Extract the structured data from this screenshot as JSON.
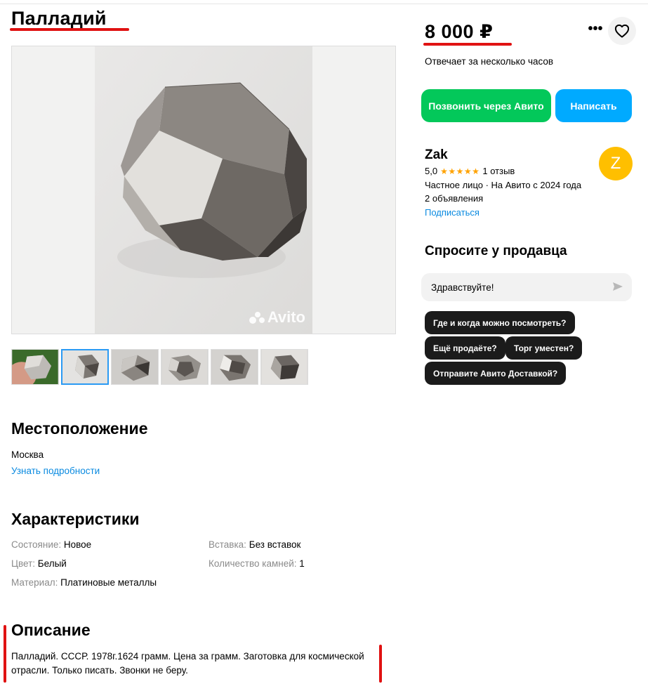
{
  "listing": {
    "title": "Палладий",
    "price": "8 000 ₽",
    "response_time": "Отвечает за несколько часов",
    "watermark": "Avito"
  },
  "actions": {
    "more_label": "•••",
    "call_label": "Позвонить через Авито",
    "write_label": "Написать"
  },
  "seller": {
    "name": "Zak",
    "rating": "5,0",
    "stars": "★★★★★",
    "reviews": "1 отзыв",
    "type": "Частное лицо · На Авито с 2024 года",
    "listings": "2 объявления",
    "subscribe_label": "Подписаться",
    "avatar_letter": "Z"
  },
  "ask": {
    "title": "Спросите у продавца",
    "input_value": "Здравствуйте!",
    "chips": [
      "Где и когда можно посмотреть?",
      "Ещё продаёте?",
      "Торг уместен?",
      "Отправите Авито Доставкой?"
    ]
  },
  "location": {
    "title": "Местоположение",
    "city": "Москва",
    "details_link": "Узнать подробности"
  },
  "characteristics": {
    "title": "Характеристики",
    "items": [
      {
        "label": "Состояние:",
        "value": "Новое"
      },
      {
        "label": "Цвет:",
        "value": "Белый"
      },
      {
        "label": "Материал:",
        "value": "Платиновые металлы"
      },
      {
        "label": "Вставка:",
        "value": "Без вставок"
      },
      {
        "label": "Количество камней:",
        "value": "1"
      }
    ]
  },
  "description": {
    "title": "Описание",
    "text": "Палладий. СССР. 1978г.1624 грамм. Цена за грамм. Заготовка для космической отрасли. Только писать. Звонки не беру."
  },
  "colors": {
    "accent_red": "#e01212",
    "call_green": "#03c85a",
    "write_blue": "#00aaff",
    "link_blue": "#0a8ae0",
    "avatar_yellow": "#ffbf00",
    "star_orange": "#ffa200"
  }
}
